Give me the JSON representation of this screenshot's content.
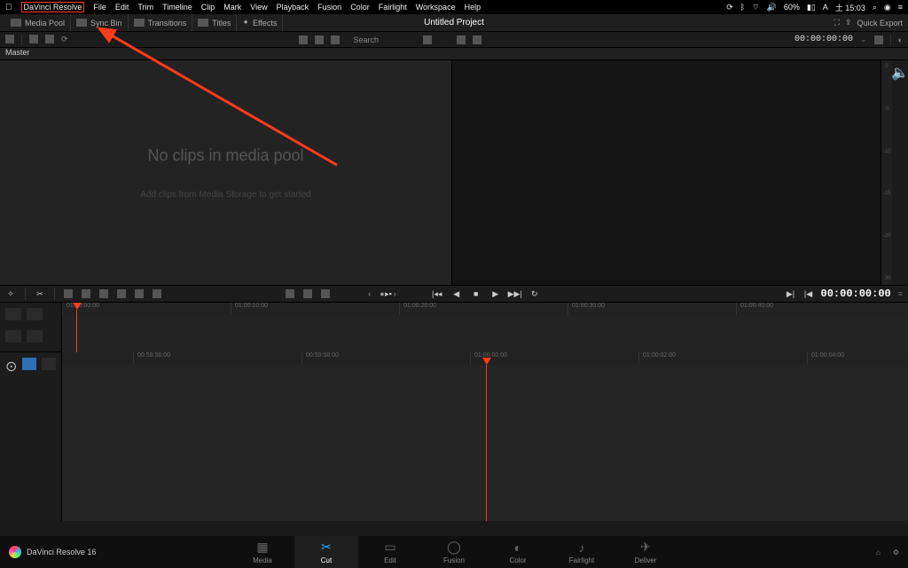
{
  "mac_menu": {
    "app_name": "DaVinci Resolve",
    "items": [
      "File",
      "Edit",
      "Trim",
      "Timeline",
      "Clip",
      "Mark",
      "View",
      "Playback",
      "Fusion",
      "Color",
      "Fairlight",
      "Workspace",
      "Help"
    ],
    "status": {
      "battery": "60%",
      "clock": "土 15:03"
    }
  },
  "toolbar": {
    "media_pool": "Media Pool",
    "sync_bin": "Sync Bin",
    "transitions": "Transitions",
    "titles": "Titles",
    "effects": "Effects",
    "project_title": "Untitled Project",
    "quick_export": "Quick Export"
  },
  "subtoolbar": {
    "search_placeholder": "Search",
    "timecode": "00:00:00:00"
  },
  "master_label": "Master",
  "media_pool_empty": {
    "title": "No clips in media pool",
    "subtitle": "Add clips from Media Storage to get started"
  },
  "viewer_ruler": [
    "0",
    "-5",
    "-10",
    "-15",
    "-20",
    "-30"
  ],
  "transport": {
    "timecode": "00:00:00:00"
  },
  "upper_ruler": [
    "01:00:00:00",
    "01:00:10:00",
    "01:00:20:00",
    "01:00:30:00",
    "01:00:40:00"
  ],
  "lower_ruler": [
    "00:59:56:00",
    "00:59:58:00",
    "01:00:00:00",
    "01:00:02:00",
    "01:00:04:00"
  ],
  "pages": {
    "media": "Media",
    "cut": "Cut",
    "edit": "Edit",
    "fusion": "Fusion",
    "color": "Color",
    "fairlight": "Fairlight",
    "deliver": "Deliver"
  },
  "brand": "DaVinci Resolve 16"
}
